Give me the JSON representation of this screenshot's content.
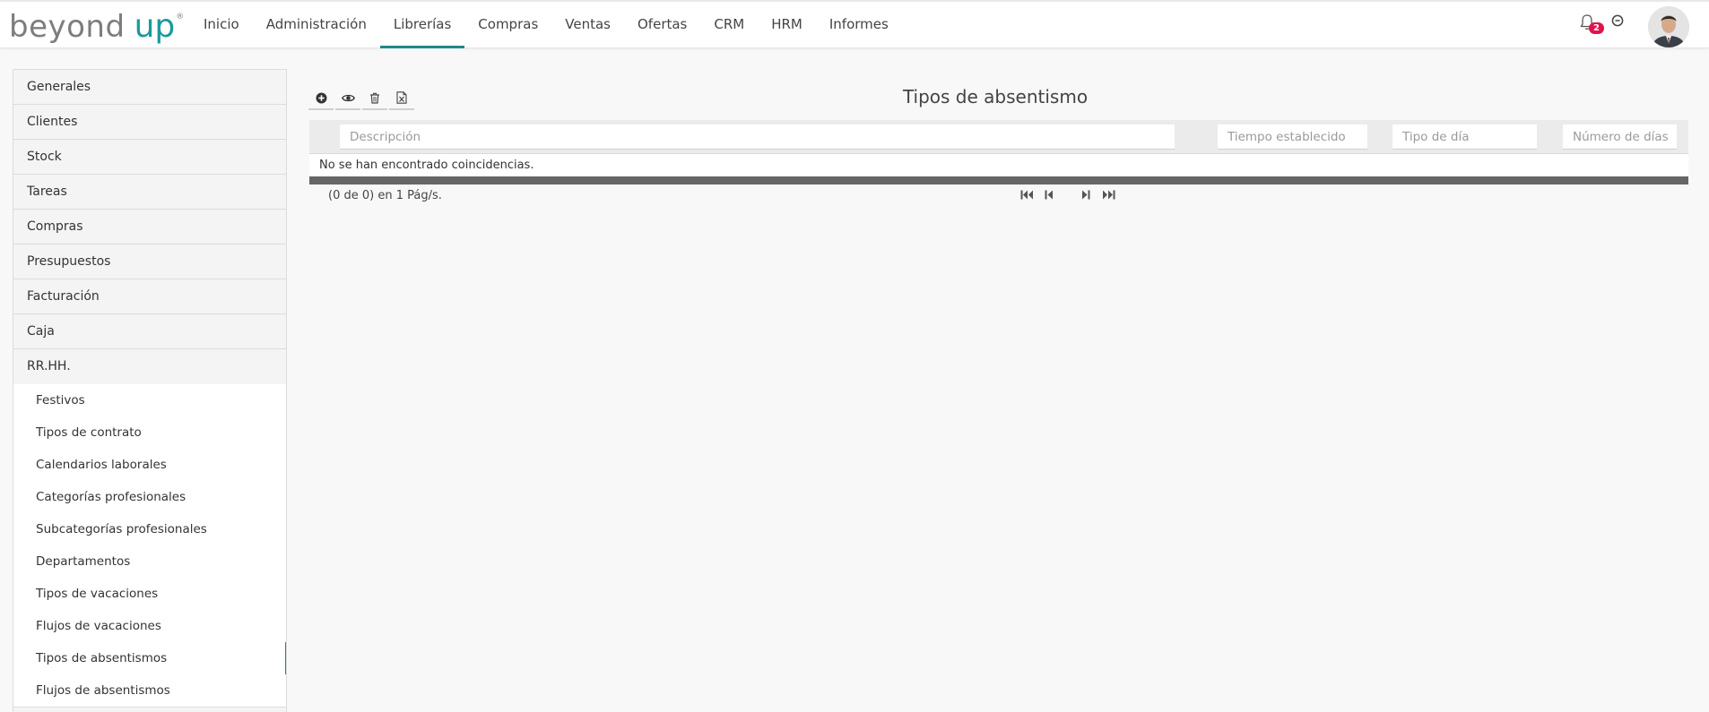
{
  "brand": {
    "logo_part1": "beyond",
    "logo_part2": "up",
    "logo_reg": "®"
  },
  "nav": {
    "items": [
      {
        "label": "Inicio",
        "active": false
      },
      {
        "label": "Administración",
        "active": false
      },
      {
        "label": "Librerías",
        "active": true
      },
      {
        "label": "Compras",
        "active": false
      },
      {
        "label": "Ventas",
        "active": false
      },
      {
        "label": "Ofertas",
        "active": false
      },
      {
        "label": "CRM",
        "active": false
      },
      {
        "label": "HRM",
        "active": false
      },
      {
        "label": "Informes",
        "active": false
      }
    ],
    "notifications_count": "2",
    "accent_color": "#1b8a8c",
    "badge_color": "#e0134d"
  },
  "sidebar": {
    "groups": [
      "Generales",
      "Clientes",
      "Stock",
      "Tareas",
      "Compras",
      "Presupuestos",
      "Facturación",
      "Caja",
      "RR.HH."
    ],
    "subitems": [
      "Festivos",
      "Tipos de contrato",
      "Calendarios laborales",
      "Categorías profesionales",
      "Subcategorías profesionales",
      "Departamentos",
      "Tipos de vacaciones",
      "Flujos de vacaciones",
      "Tipos de absentismos",
      "Flujos de absentismos"
    ],
    "active_subitem": "Tipos de absentismos"
  },
  "toolbar": {
    "icons": [
      "add-icon",
      "view-icon",
      "delete-icon",
      "export-excel-icon"
    ]
  },
  "page": {
    "title": "Tipos de absentismo"
  },
  "grid": {
    "filters": {
      "descripcion": "Descripción",
      "tiempo": "Tiempo establecido",
      "tipo_dia": "Tipo de día",
      "numero_dias": "Número de días"
    },
    "empty_message": "No se han encontrado coincidencias.",
    "page_info": "(0 de 0) en 1 Pág/s."
  }
}
